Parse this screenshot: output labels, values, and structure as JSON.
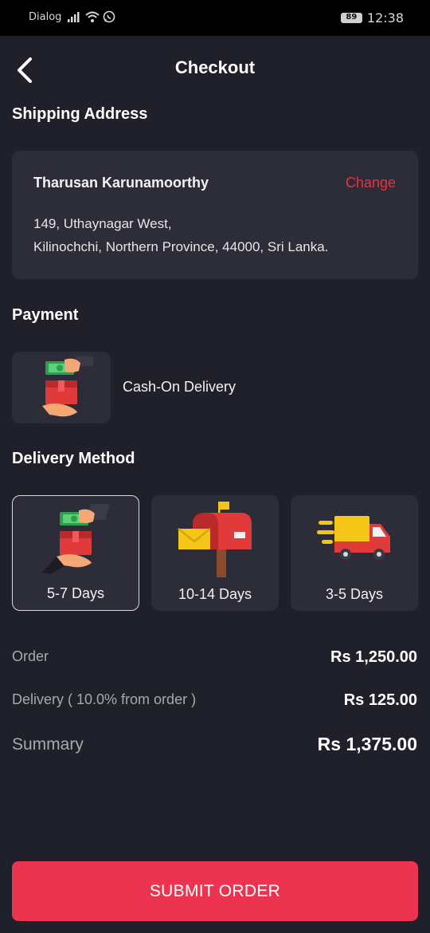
{
  "status_bar": {
    "carrier": "Dialog",
    "battery": "89",
    "time": "12:38"
  },
  "header": {
    "title": "Checkout"
  },
  "shipping": {
    "section_title": "Shipping Address",
    "name": "Tharusan Karunamoorthy",
    "change_label": "Change",
    "address_line1": "149, Uthaynagar West,",
    "address_line2": "Kilinochchi, Northern Province, 44000, Sri Lanka."
  },
  "payment": {
    "section_title": "Payment",
    "method_label": "Cash-On Delivery"
  },
  "delivery": {
    "section_title": "Delivery Method",
    "options": [
      {
        "label": "5-7 Days",
        "icon": "cash-delivery-icon",
        "selected": true
      },
      {
        "label": "10-14 Days",
        "icon": "mailbox-icon",
        "selected": false
      },
      {
        "label": "3-5 Days",
        "icon": "delivery-truck-icon",
        "selected": false
      }
    ]
  },
  "totals": {
    "order_label": "Order",
    "order_value": "Rs 1,250.00",
    "delivery_label": "Delivery ( 10.0% from order )",
    "delivery_value": "Rs 125.00",
    "summary_label": "Summary",
    "summary_value": "Rs 1,375.00"
  },
  "submit": {
    "label": "SUBMIT ORDER"
  },
  "colors": {
    "background": "#1f2029",
    "card": "#2c2d38",
    "accent": "#ec3450",
    "change_link": "#e8323e"
  }
}
